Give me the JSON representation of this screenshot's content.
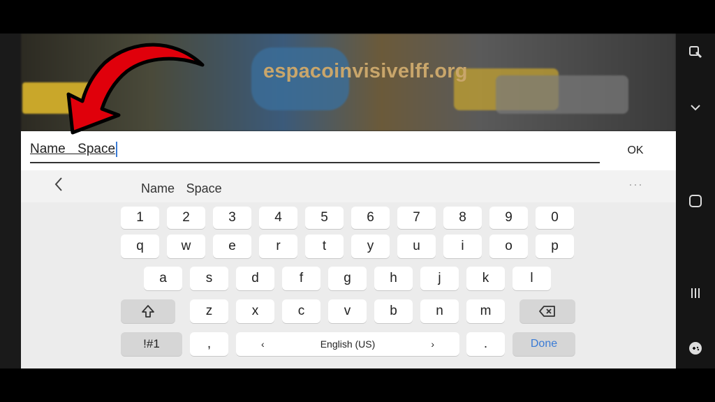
{
  "watermark": "espacoinvisivelff.org",
  "input": {
    "value": "NameㅤSpace",
    "ok_label": "OK"
  },
  "suggestion": {
    "word": "NameㅤSpace",
    "more": "···"
  },
  "keys": {
    "digits": [
      "1",
      "2",
      "3",
      "4",
      "5",
      "6",
      "7",
      "8",
      "9",
      "0"
    ],
    "row1": [
      "q",
      "w",
      "e",
      "r",
      "t",
      "y",
      "u",
      "i",
      "o",
      "p"
    ],
    "row2": [
      "a",
      "s",
      "d",
      "f",
      "g",
      "h",
      "j",
      "k",
      "l"
    ],
    "row3": [
      "z",
      "x",
      "c",
      "v",
      "b",
      "n",
      "m"
    ],
    "symbols": "!#1",
    "comma": ",",
    "lang_prev": "‹",
    "space": "English (US)",
    "lang_next": "›",
    "period": ".",
    "done": "Done"
  },
  "icons": {
    "shift": "shift-icon",
    "backspace": "backspace-icon",
    "back": "chevron-left-icon",
    "arrow": "red-arrow-icon"
  },
  "colors": {
    "accent": "#3a7bd5",
    "watermark": "#c9a66b",
    "arrow": "#e0000b"
  }
}
